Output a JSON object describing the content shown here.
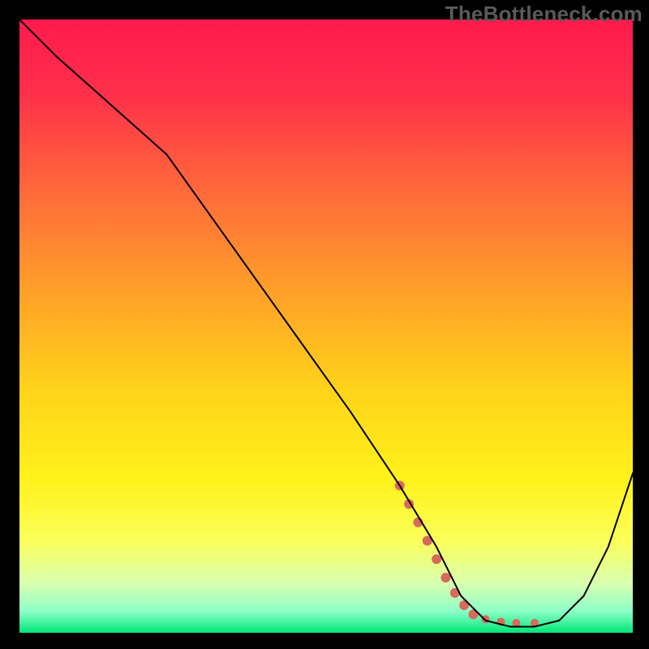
{
  "watermark": "TheBottleneck.com",
  "chart_data": {
    "type": "line",
    "title": "",
    "xlabel": "",
    "ylabel": "",
    "xlim": [
      0,
      100
    ],
    "ylim": [
      0,
      100
    ],
    "grid": false,
    "legend": false,
    "annotations": [],
    "background_gradient": {
      "stops": [
        {
          "offset": 0.0,
          "color": "#ff1a4d"
        },
        {
          "offset": 0.12,
          "color": "#ff2f4a"
        },
        {
          "offset": 0.28,
          "color": "#ff6a3a"
        },
        {
          "offset": 0.45,
          "color": "#ffa228"
        },
        {
          "offset": 0.6,
          "color": "#ffd21a"
        },
        {
          "offset": 0.75,
          "color": "#fff21a"
        },
        {
          "offset": 0.85,
          "color": "#fbff5a"
        },
        {
          "offset": 0.92,
          "color": "#d8ffb0"
        },
        {
          "offset": 0.965,
          "color": "#8cffc8"
        },
        {
          "offset": 1.0,
          "color": "#00e676"
        }
      ]
    },
    "series": [
      {
        "name": "bottleneck-curve",
        "color": "#000000",
        "stroke_width": 2,
        "x": [
          0,
          6,
          15,
          24,
          34,
          44,
          54,
          62,
          68,
          72,
          76,
          80,
          84,
          88,
          92,
          96,
          100
        ],
        "y": [
          100,
          94,
          86,
          78,
          64,
          50,
          36,
          24,
          14,
          6,
          2,
          1,
          1,
          2,
          6,
          14,
          26
        ]
      }
    ],
    "highlight": {
      "name": "selected-range",
      "color": "#d86a5a",
      "points": [
        {
          "x": 62,
          "y": 24,
          "r": 6
        },
        {
          "x": 63.5,
          "y": 21,
          "r": 6
        },
        {
          "x": 65,
          "y": 18,
          "r": 6
        },
        {
          "x": 66.5,
          "y": 15,
          "r": 6
        },
        {
          "x": 68,
          "y": 12,
          "r": 6
        },
        {
          "x": 69.5,
          "y": 9,
          "r": 6
        },
        {
          "x": 71,
          "y": 6.5,
          "r": 6
        },
        {
          "x": 72.5,
          "y": 4.5,
          "r": 6
        },
        {
          "x": 74,
          "y": 3,
          "r": 6
        },
        {
          "x": 76,
          "y": 2.2,
          "r": 5
        },
        {
          "x": 78.5,
          "y": 1.8,
          "r": 5
        },
        {
          "x": 81,
          "y": 1.6,
          "r": 5
        },
        {
          "x": 84,
          "y": 1.6,
          "r": 5
        }
      ]
    }
  }
}
